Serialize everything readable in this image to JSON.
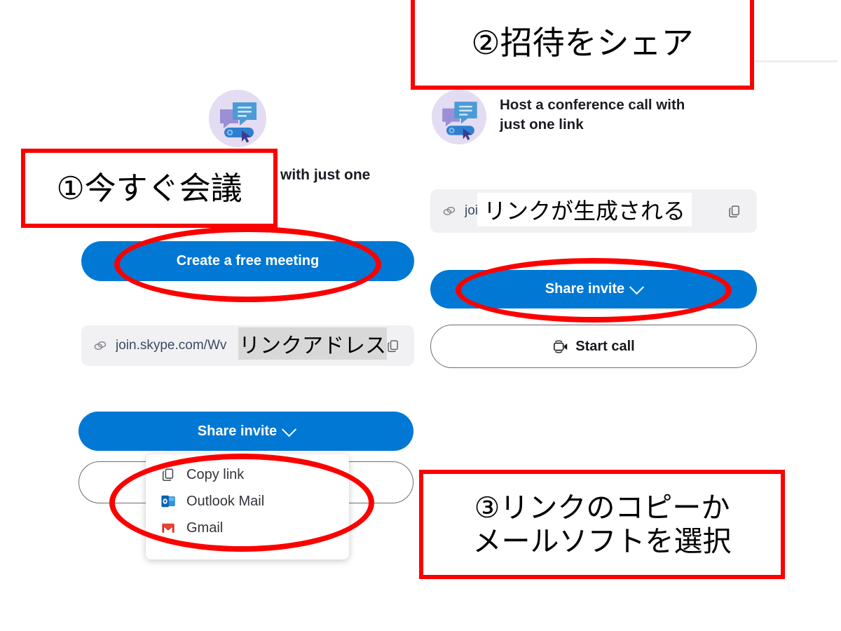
{
  "app": {
    "name": "Skype",
    "accent_color": "#0078d4",
    "annotation_color": "#fc0000",
    "link_field_bg": "#f1f1f3"
  },
  "left_panel": {
    "icon_name": "conference-call-link-icon",
    "heading_visible_fragment": "with just one",
    "create_button_label": "Create a free meeting",
    "link_field": {
      "chain_icon": "link-chain-icon",
      "value": "join.skype.com/Wv",
      "copy_icon": "copy-icon"
    }
  },
  "right_panel": {
    "icon_name": "conference-call-link-icon",
    "heading": "Host a conference call with just one link",
    "link_field": {
      "chain_icon": "link-chain-icon",
      "value": "join",
      "copy_icon": "copy-icon"
    },
    "share_button_label": "Share invite",
    "share_button_chevron": "chevron-down-icon",
    "start_call_label": "Start call",
    "start_call_icon": "video-camera-icon"
  },
  "bottom_panel": {
    "share_button_label": "Share invite",
    "share_button_chevron": "chevron-down-icon",
    "dropdown": {
      "items": [
        {
          "label": "Copy link",
          "icon": "copy-icon"
        },
        {
          "label": "Outlook Mail",
          "icon": "outlook-icon"
        },
        {
          "label": "Gmail",
          "icon": "gmail-icon"
        }
      ]
    }
  },
  "annotations": {
    "step1": "①今すぐ会議",
    "step2": "②招待をシェア",
    "step3_line1": "③リンクのコピーか",
    "step3_line2": "メールソフトを選択",
    "link_address_label": "リンクアドレス",
    "link_generated_label": "リンクが生成される"
  }
}
